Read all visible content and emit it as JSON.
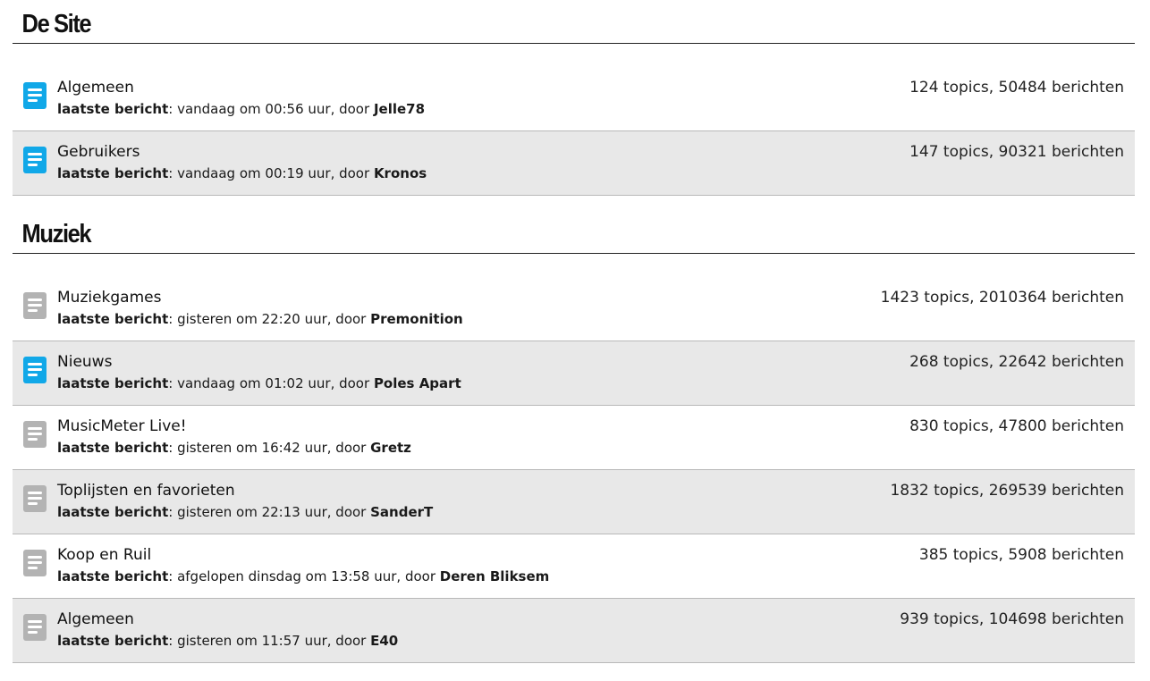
{
  "colors": {
    "active_icon": "#11a8e8",
    "inactive_icon": "#b3b3b3",
    "alt_row": "#e8e8e8"
  },
  "sections": [
    {
      "title": "De Site",
      "forums": [
        {
          "name": "Algemeen",
          "last_label": "laatste bericht",
          "last_text": ": vandaag om 00:56 uur, door ",
          "author": "Jelle78",
          "stats": "124 topics, 50484 berichten",
          "icon": "forum-unread-icon"
        },
        {
          "name": "Gebruikers",
          "last_label": "laatste bericht",
          "last_text": ": vandaag om 00:19 uur, door ",
          "author": "Kronos",
          "stats": "147 topics, 90321 berichten",
          "icon": "forum-unread-icon"
        }
      ]
    },
    {
      "title": "Muziek",
      "forums": [
        {
          "name": "Muziekgames",
          "last_label": "laatste bericht",
          "last_text": ": gisteren om 22:20 uur, door ",
          "author": "Premonition",
          "stats": "1423 topics, 2010364 berichten",
          "icon": "forum-read-icon"
        },
        {
          "name": "Nieuws",
          "last_label": "laatste bericht",
          "last_text": ": vandaag om 01:02 uur, door ",
          "author": "Poles Apart",
          "stats": "268 topics, 22642 berichten",
          "icon": "forum-unread-icon"
        },
        {
          "name": "MusicMeter Live!",
          "last_label": "laatste bericht",
          "last_text": ": gisteren om 16:42 uur, door ",
          "author": "Gretz",
          "stats": "830 topics, 47800 berichten",
          "icon": "forum-read-icon"
        },
        {
          "name": "Toplijsten en favorieten",
          "last_label": "laatste bericht",
          "last_text": ": gisteren om 22:13 uur, door ",
          "author": "SanderT",
          "stats": "1832 topics, 269539 berichten",
          "icon": "forum-read-icon"
        },
        {
          "name": "Koop en Ruil",
          "last_label": "laatste bericht",
          "last_text": ": afgelopen dinsdag om 13:58 uur, door ",
          "author": "Deren Bliksem",
          "stats": "385 topics, 5908 berichten",
          "icon": "forum-read-icon"
        },
        {
          "name": "Algemeen",
          "last_label": "laatste bericht",
          "last_text": ": gisteren om 11:57 uur, door ",
          "author": "E40",
          "stats": "939 topics, 104698 berichten",
          "icon": "forum-read-icon"
        }
      ]
    }
  ]
}
